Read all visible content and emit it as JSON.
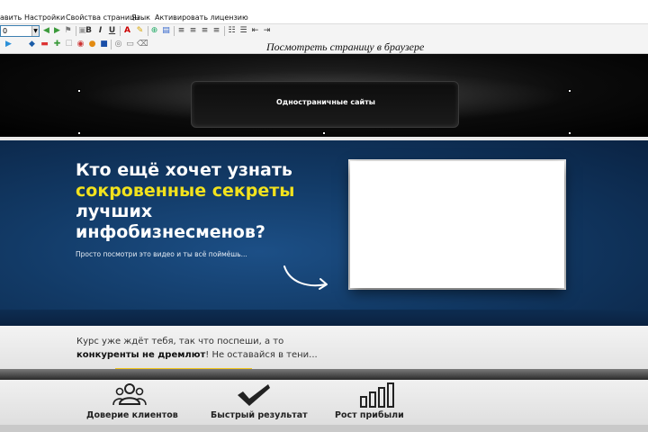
{
  "menu": {
    "items": [
      "авить",
      "Настройки",
      "Свойства страницы",
      "Язык",
      "Активировать лицензию"
    ]
  },
  "toolbar": {
    "font_size_value": "0",
    "bold": "B",
    "italic": "I",
    "underline": "U"
  },
  "preview_link": "Посмотреть страницу в браузере",
  "header": {
    "nav_title": "Одностраничные сайты"
  },
  "hero": {
    "headline_line1": "Кто ещё хочет узнать",
    "headline_highlight": "сокровенные секреты",
    "headline_line3": "лучших",
    "headline_line4": "инфобизнесменов?",
    "subline": "Просто посмотри это видео и ты всё поймёшь..."
  },
  "course": {
    "text_part1": "Курс уже ждёт тебя, так что поспеши, а то ",
    "text_bold": "конкуренты не дремлют",
    "text_part2": "! Не оставайся в тени..."
  },
  "features": [
    {
      "label": "Доверие клиентов",
      "icon": "people-group-icon"
    },
    {
      "label": "Быстрый результат",
      "icon": "checkmark-icon"
    },
    {
      "label": "Рост прибыли",
      "icon": "bar-chart-icon"
    }
  ],
  "colors": {
    "headline_highlight": "#f2e21d",
    "hero_blue": "#123a66",
    "accent_line": "#f0c419"
  }
}
